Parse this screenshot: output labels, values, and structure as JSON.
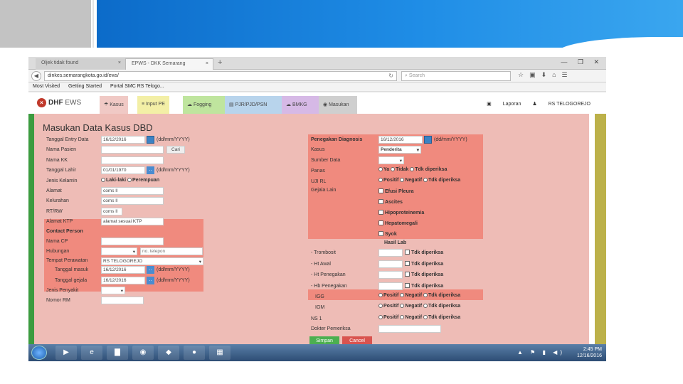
{
  "browser": {
    "tab1": "Oljek tidak found",
    "tab2": "EPWS - DKK Semarang",
    "tab_close": "×",
    "new_tab": "+",
    "win_controls": "—  ❐  ✕",
    "url": "dinkes.semarangkota.go.id/ews/",
    "url_tools": "↻",
    "search_placeholder": "Search",
    "bookmarks": [
      "Most Visited",
      "Getting Started",
      "Portal SMC RS Telogo..."
    ]
  },
  "app": {
    "logo": "DHF",
    "logo_sub": "EWS",
    "logo_icon": "×",
    "menu": [
      {
        "label": "Kasus",
        "color": "#f0c9c5"
      },
      {
        "label": "Input PE",
        "color": "#f3efa6"
      },
      {
        "label": "Fogging",
        "color": "#bfe59e"
      },
      {
        "label": "PJR/PJD/PSN",
        "color": "#b8d4ec"
      },
      {
        "label": "BMKG",
        "color": "#d6b9e6"
      },
      {
        "label": "Masukan",
        "color": "#cfcfcf"
      }
    ],
    "laporan": "Laporan",
    "user": "RS TELOGOREJO"
  },
  "form": {
    "title": "Masukan Data Kasus DBD",
    "tanggal_entry_label": "Tanggal Entry Data",
    "tanggal_entry_value": "16/12/2016",
    "date_format": "(dd/mm/YYYY)",
    "nama_pasien_label": "Nama Pasien",
    "cari_button": "Cari",
    "nama_kk_label": "Nama KK",
    "tanggal_lahir_label": "Tanggal Lahir",
    "tanggal_lahir_value": "01/01/1970",
    "jenis_kelamin_label": "Jenis Kelamin",
    "laki": "Laki-laki",
    "perempuan": "Perempuan",
    "alamat_label": "Alamat",
    "alamat_value": "coms ll",
    "kelurahan_label": "Kelurahan",
    "kelurahan_value": "coms ll",
    "rt_rw_label": "RT/RW",
    "rt_rw_value": "coms ll",
    "alamat_ktp_label": "Alamat KTP",
    "alamat_ktp_value": "alamat sesuai KTP",
    "contact_person_label": "Contact Person",
    "nama_cp_label": "Nama CP",
    "hubungan_label": "Hubungan",
    "telepon_placeholder": "no. telepon",
    "tempat_perawatan_label": "Tempat Perawatan",
    "tempat_perawatan_value": "RS TELOGOREJO",
    "tanggal_masuk_label": "Tanggal masuk",
    "tanggal_masuk_value": "16/12/2016",
    "tanggal_gejala_label": "Tanggal gejala",
    "tanggal_gejala_value": "16/12/2016",
    "jenis_penyakit_label": "Jenis Penyakit",
    "nomor_rm_label": "Nomor RM",
    "dropdown_arrow": "▾",
    "small_button": "..",
    "penegakan_label": "Penegakan Diagnosis",
    "penegakan_value": "16/12/2016",
    "kasus_label": "Kasus",
    "kasus_value": "Penderita",
    "sumber_data_label": "Sumber Data",
    "panas_label": "Panas",
    "ya": "Ya",
    "tidak": "Tidak",
    "tdk_diperiksa": "Tdk diperiksa",
    "uji_rl_label": "UJI RL",
    "positif": "Positif",
    "negatif": "Negatif",
    "gejala_lain_label": "Gejala Lain",
    "gejala": [
      "Efusi Pleura",
      "Ascites",
      "Hipoproteinemia",
      "Hepatomegali",
      "Syok"
    ],
    "hasil_lab_label": "Hasil Lab",
    "lab_rows": [
      "- Trombosit",
      "- Ht Awal",
      "- Ht Penegakan",
      "- Hb Penegakan"
    ],
    "igg_label": "IGG",
    "igm_label": "IGM",
    "ns1_label": "NS 1",
    "dokter_label": "Dokter Pemeriksa",
    "simpan_button": "Simpan",
    "cancel_button": "Cancel"
  },
  "taskbar": {
    "time": "2:45 PM",
    "date": "12/16/2016",
    "tray": "▲ ⚑ ▮ ◀)"
  }
}
